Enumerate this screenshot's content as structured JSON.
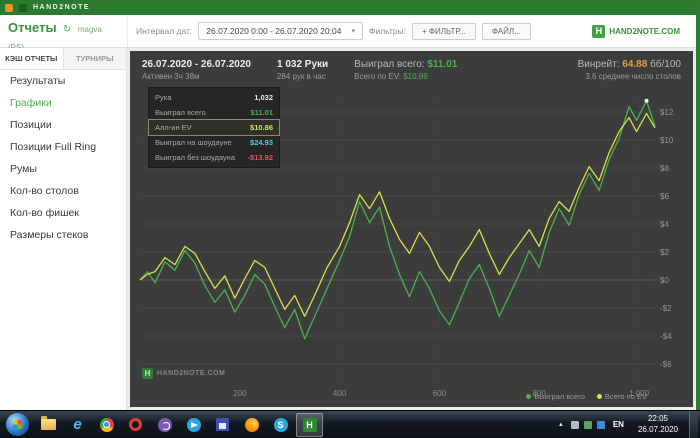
{
  "titlebar": {
    "title": "HAND2NOTE"
  },
  "header": {
    "page_title": "Отчеты",
    "account": "magva (PS)",
    "interval_label": "Интервал дат:",
    "interval_value": "26.07.2020 0:00 - 26.07.2020 20:04",
    "filters_label": "Фильтры:",
    "filter_button": "+ ФИЛЬТР...",
    "file_button": "ФАЙЛ...",
    "brand": "HAND2NOTE.COM"
  },
  "sidebar": {
    "tabs": [
      {
        "label": "КЭШ ОТЧЕТЫ",
        "active": true
      },
      {
        "label": "ТУРНИРЫ",
        "active": false
      }
    ],
    "items": [
      {
        "label": "Результаты",
        "active": false
      },
      {
        "label": "Графики",
        "active": true
      },
      {
        "label": "Позиции",
        "active": false
      },
      {
        "label": "Позиции Full Ring",
        "active": false
      },
      {
        "label": "Румы",
        "active": false
      },
      {
        "label": "Кол-во столов",
        "active": false
      },
      {
        "label": "Кол-во фишек",
        "active": false
      },
      {
        "label": "Размеры стеков",
        "active": false
      }
    ]
  },
  "stats": {
    "date_range": "26.07.2020 - 26.07.2020",
    "active_time": "Активен 3ч 38м",
    "hands": "1 032 Руки",
    "hands_per_hour": "284 рук в час",
    "won_label": "Выиграл всего:",
    "won_value": "$11.01",
    "ev_label": "Всего по EV:",
    "ev_value": "$10.86",
    "winrate_label": "Винрейт:",
    "winrate_value": "64.88",
    "winrate_unit": "бб/100",
    "avg_tables": "3.6 среднее число столов"
  },
  "tooltip": {
    "rows": [
      {
        "label": "Рука",
        "value": "1,032",
        "color": "#e8e8e8",
        "highlight": false
      },
      {
        "label": "Выиграл всего",
        "value": "$11.01",
        "color": "#4caf50",
        "highlight": false
      },
      {
        "label": "Алл-ин EV",
        "value": "$10.86",
        "color": "#d7e14a",
        "highlight": true
      },
      {
        "label": "Выиграл на шоудауне",
        "value": "$24.93",
        "color": "#4dd0e1",
        "highlight": false
      },
      {
        "label": "Выиграл без шоудауна",
        "value": "-$13.92",
        "color": "#ef5350",
        "highlight": false
      }
    ]
  },
  "watermark": "HAND2NOTE.COM",
  "colors": {
    "accent_green": "#4caf50",
    "accent_yellow": "#d7e14a",
    "winrate_orange": "#e0a03c",
    "chart_bg": "#3c3c3c"
  },
  "chart_data": {
    "type": "line",
    "title": "",
    "xlabel": "",
    "ylabel": "",
    "xlim": [
      0,
      1032
    ],
    "ylim": [
      -7.5,
      13.5
    ],
    "x_ticks": [
      "200",
      "400",
      "600",
      "800",
      "1 000"
    ],
    "x_tick_values": [
      200,
      400,
      600,
      800,
      1000
    ],
    "y_ticks": [
      "$12",
      "$10",
      "$8",
      "$6",
      "$4",
      "$2",
      "$0",
      "-$2",
      "-$4",
      "-$6"
    ],
    "y_tick_values": [
      12,
      10,
      8,
      6,
      4,
      2,
      0,
      -2,
      -4,
      -6
    ],
    "grid": true,
    "legend_position": "bottom-right",
    "legend": [
      {
        "name": "Выиграл всего",
        "color": "#4caf50"
      },
      {
        "name": "Всего по EV",
        "color": "#d7e14a"
      }
    ],
    "series": [
      {
        "name": "Выиграл всего",
        "color": "#4caf50",
        "points": [
          [
            0,
            0
          ],
          [
            15,
            0.6
          ],
          [
            30,
            -0.2
          ],
          [
            50,
            1.3
          ],
          [
            70,
            0.7
          ],
          [
            90,
            2.1
          ],
          [
            110,
            1.2
          ],
          [
            130,
            -0.4
          ],
          [
            150,
            -1.6
          ],
          [
            170,
            -0.7
          ],
          [
            190,
            -2.3
          ],
          [
            210,
            -1.1
          ],
          [
            230,
            0.4
          ],
          [
            250,
            -0.3
          ],
          [
            270,
            -1.9
          ],
          [
            290,
            -3.4
          ],
          [
            310,
            -2.1
          ],
          [
            330,
            -4.2
          ],
          [
            350,
            -2.6
          ],
          [
            375,
            -0.6
          ],
          [
            400,
            1.4
          ],
          [
            420,
            3.1
          ],
          [
            440,
            5.6
          ],
          [
            460,
            4.1
          ],
          [
            480,
            5.2
          ],
          [
            500,
            2.4
          ],
          [
            520,
            0.4
          ],
          [
            540,
            -1.2
          ],
          [
            560,
            0.6
          ],
          [
            580,
            -0.6
          ],
          [
            600,
            -2.2
          ],
          [
            620,
            -3.2
          ],
          [
            640,
            -1.6
          ],
          [
            660,
            0.1
          ],
          [
            680,
            1.1
          ],
          [
            700,
            -0.6
          ],
          [
            720,
            -2.6
          ],
          [
            740,
            -1.1
          ],
          [
            760,
            0.4
          ],
          [
            780,
            2.1
          ],
          [
            800,
            0.9
          ],
          [
            820,
            3.4
          ],
          [
            840,
            5.1
          ],
          [
            860,
            3.9
          ],
          [
            880,
            6.1
          ],
          [
            900,
            7.6
          ],
          [
            920,
            6.4
          ],
          [
            940,
            8.6
          ],
          [
            960,
            10.1
          ],
          [
            980,
            12.4
          ],
          [
            995,
            11.4
          ],
          [
            1015,
            12.8
          ],
          [
            1032,
            11.01
          ]
        ]
      },
      {
        "name": "Всего по EV",
        "color": "#d7e14a",
        "points": [
          [
            0,
            0
          ],
          [
            15,
            0.4
          ],
          [
            30,
            0.6
          ],
          [
            50,
            1.6
          ],
          [
            70,
            1.1
          ],
          [
            90,
            2.4
          ],
          [
            110,
            1.9
          ],
          [
            130,
            0.6
          ],
          [
            150,
            -0.6
          ],
          [
            170,
            0.3
          ],
          [
            190,
            -1.3
          ],
          [
            210,
            0.1
          ],
          [
            230,
            1.4
          ],
          [
            250,
            0.9
          ],
          [
            270,
            -0.6
          ],
          [
            290,
            -2.1
          ],
          [
            310,
            -1.1
          ],
          [
            330,
            -2.6
          ],
          [
            350,
            -1.1
          ],
          [
            375,
            0.9
          ],
          [
            400,
            2.4
          ],
          [
            420,
            4.1
          ],
          [
            440,
            6.1
          ],
          [
            460,
            5.1
          ],
          [
            480,
            6.3
          ],
          [
            500,
            4.4
          ],
          [
            520,
            2.9
          ],
          [
            540,
            1.9
          ],
          [
            560,
            3.4
          ],
          [
            580,
            2.4
          ],
          [
            600,
            0.9
          ],
          [
            620,
            -0.1
          ],
          [
            640,
            1.4
          ],
          [
            660,
            2.4
          ],
          [
            680,
            3.6
          ],
          [
            700,
            1.9
          ],
          [
            720,
            0.4
          ],
          [
            740,
            1.6
          ],
          [
            760,
            2.6
          ],
          [
            780,
            3.6
          ],
          [
            800,
            2.4
          ],
          [
            820,
            4.4
          ],
          [
            840,
            5.6
          ],
          [
            860,
            4.9
          ],
          [
            880,
            6.6
          ],
          [
            900,
            8.1
          ],
          [
            920,
            7.1
          ],
          [
            940,
            9.1
          ],
          [
            960,
            10.6
          ],
          [
            980,
            11.6
          ],
          [
            995,
            10.6
          ],
          [
            1015,
            11.9
          ],
          [
            1032,
            10.86
          ]
        ]
      }
    ]
  },
  "taskbar": {
    "lang": "EN",
    "time": "22:05",
    "date": "26.07.2020"
  }
}
